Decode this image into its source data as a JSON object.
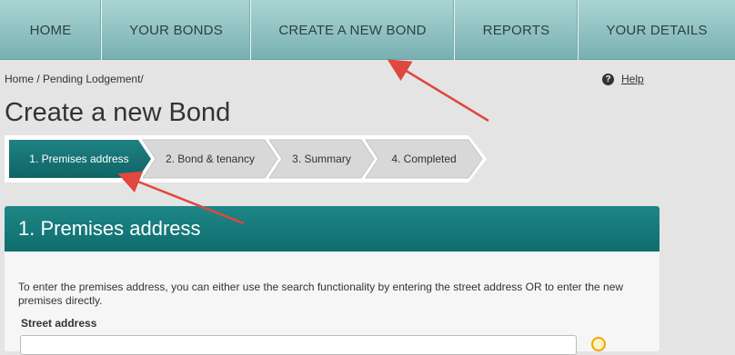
{
  "nav": {
    "items": [
      {
        "label": "HOME"
      },
      {
        "label": "YOUR BONDS"
      },
      {
        "label": "CREATE A NEW BOND"
      },
      {
        "label": "REPORTS"
      },
      {
        "label": "YOUR DETAILS"
      }
    ]
  },
  "breadcrumb": "Home / Pending Lodgement/",
  "help": {
    "label": "Help"
  },
  "page_title": "Create a new Bond",
  "steps": [
    {
      "label": "1. Premises address",
      "active": true
    },
    {
      "label": "2. Bond & tenancy",
      "active": false
    },
    {
      "label": "3. Summary",
      "active": false
    },
    {
      "label": "4. Completed",
      "active": false
    }
  ],
  "panel": {
    "title": "1. Premises address",
    "description": "To enter the premises address, you can either use the search functionality by entering the street address OR to enter the new premises directly.",
    "street_label": "Street address",
    "street_value": ""
  },
  "colors": {
    "nav_bg": "#8fc1c1",
    "active_step": "#1a7576",
    "panel_header": "#167a7b",
    "annotation_arrow": "#e0473e"
  }
}
